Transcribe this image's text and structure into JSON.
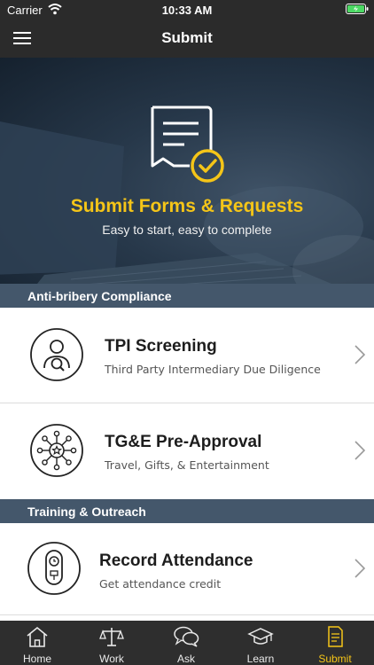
{
  "status_bar": {
    "carrier": "Carrier",
    "time": "10:33 AM"
  },
  "header": {
    "title": "Submit"
  },
  "hero": {
    "title": "Submit Forms & Requests",
    "subtitle": "Easy to start, easy to complete"
  },
  "sections": [
    {
      "title": "Anti-bribery Compliance",
      "items": [
        {
          "title": "TPI Screening",
          "subtitle": "Third Party Intermediary Due Diligence",
          "icon": "person-search-icon"
        },
        {
          "title": "TG&E Pre-Approval",
          "subtitle": "Travel, Gifts, & Entertainment",
          "icon": "network-star-icon"
        }
      ]
    },
    {
      "title": "Training & Outreach",
      "items": [
        {
          "title": "Record Attendance",
          "subtitle": "Get attendance credit",
          "icon": "badge-clock-icon"
        }
      ]
    }
  ],
  "tabs": [
    {
      "label": "Home",
      "icon": "home-icon"
    },
    {
      "label": "Work",
      "icon": "scales-icon"
    },
    {
      "label": "Ask",
      "icon": "chat-bubbles-icon"
    },
    {
      "label": "Learn",
      "icon": "graduation-cap-icon"
    },
    {
      "label": "Submit",
      "icon": "document-icon",
      "active": true
    }
  ],
  "colors": {
    "accent": "#f5c518",
    "section_bg": "#44576b",
    "bar_bg": "#2b2b2b"
  }
}
